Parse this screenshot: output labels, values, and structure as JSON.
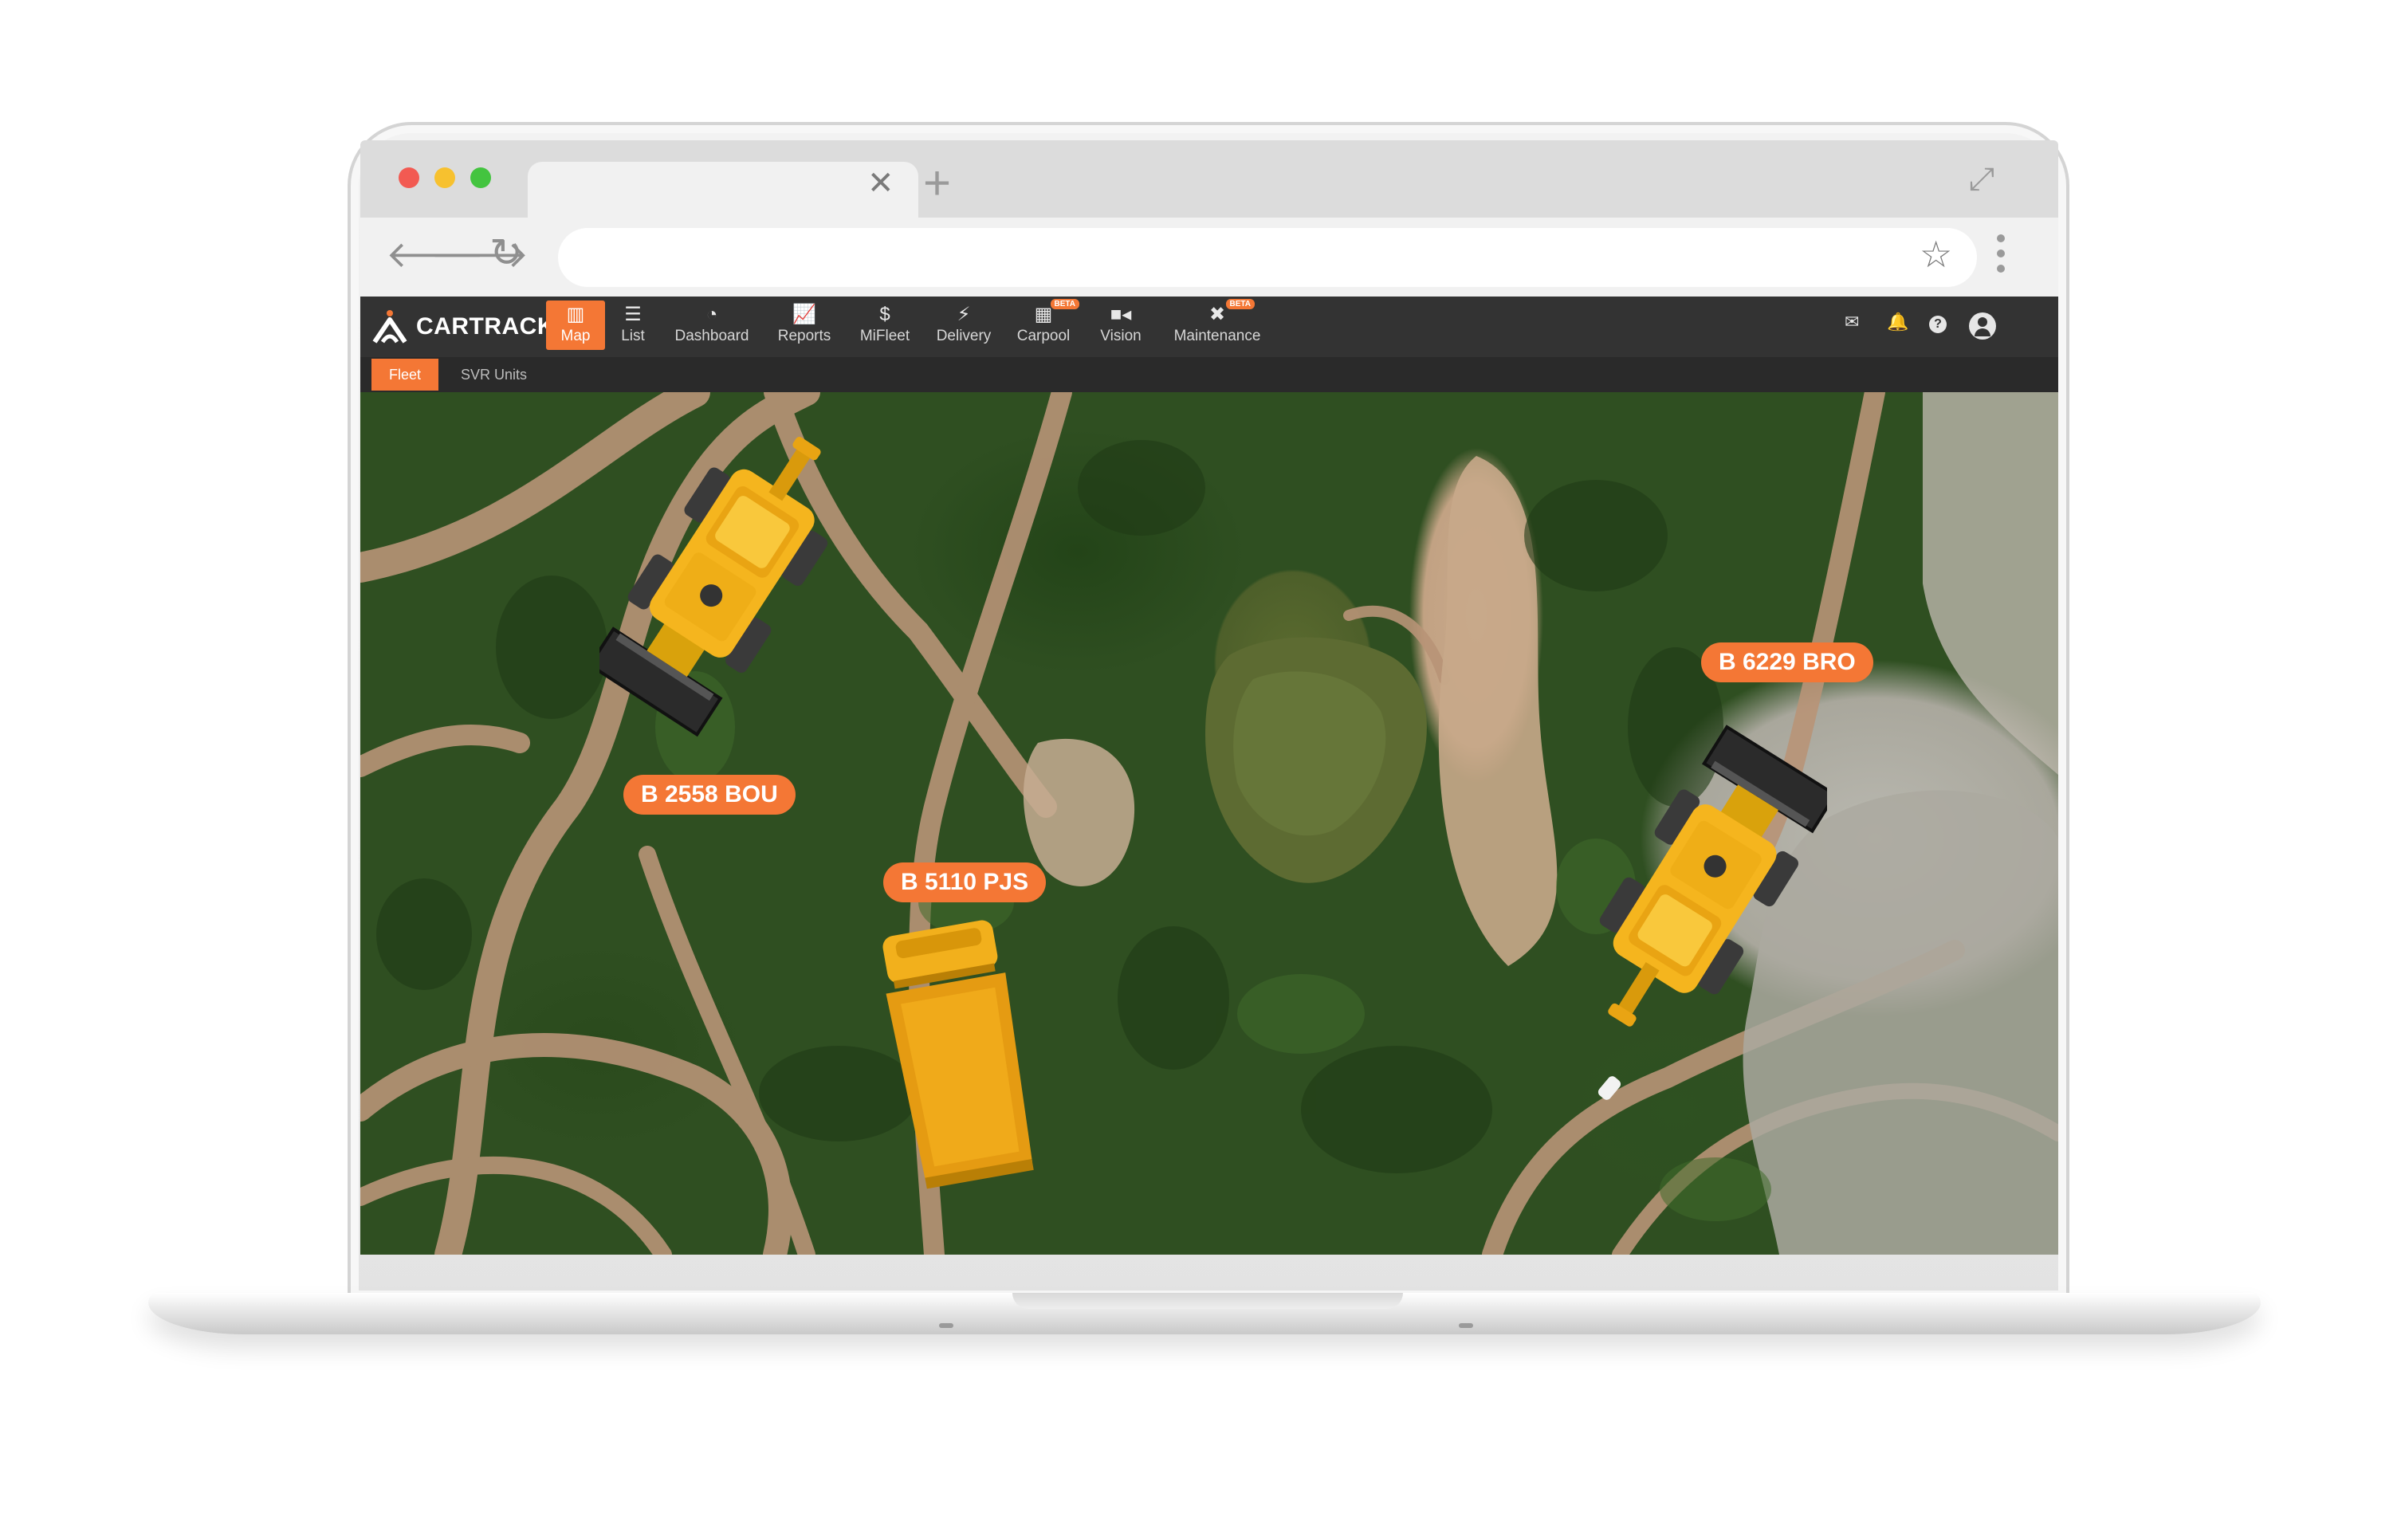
{
  "browser": {
    "traffic_lights": [
      "#f25a52",
      "#f7c12f",
      "#43c43f"
    ],
    "tab_close_icon": "close-icon",
    "new_tab_icon": "plus-icon",
    "address_value": ""
  },
  "app": {
    "brand": "CARTRACK",
    "accent": "#f47735",
    "nav": [
      {
        "label": "Map",
        "icon": "map-icon",
        "active": true
      },
      {
        "label": "List",
        "icon": "list-icon"
      },
      {
        "label": "Dashboard",
        "icon": "gauge-icon"
      },
      {
        "label": "Reports",
        "icon": "chart-icon"
      },
      {
        "label": "MiFleet",
        "icon": "dollar-icon"
      },
      {
        "label": "Delivery",
        "icon": "bolt-icon"
      },
      {
        "label": "Carpool",
        "icon": "calendar-icon",
        "badge": "BETA"
      },
      {
        "label": "Vision",
        "icon": "camera-icon"
      },
      {
        "label": "Maintenance",
        "icon": "tools-icon",
        "badge": "BETA"
      }
    ],
    "header_icons": [
      "mail-icon",
      "bell-icon",
      "help-icon",
      "user-icon"
    ],
    "subtabs": [
      {
        "label": "Fleet",
        "active": true
      },
      {
        "label": "SVR Units"
      }
    ]
  },
  "map": {
    "vehicles": [
      {
        "plate": "B 2558 BOU",
        "type": "wheel loader"
      },
      {
        "plate": "B 5110 PJS",
        "type": "dump truck"
      },
      {
        "plate": "B 6229 BRO",
        "type": "wheel loader"
      }
    ]
  }
}
